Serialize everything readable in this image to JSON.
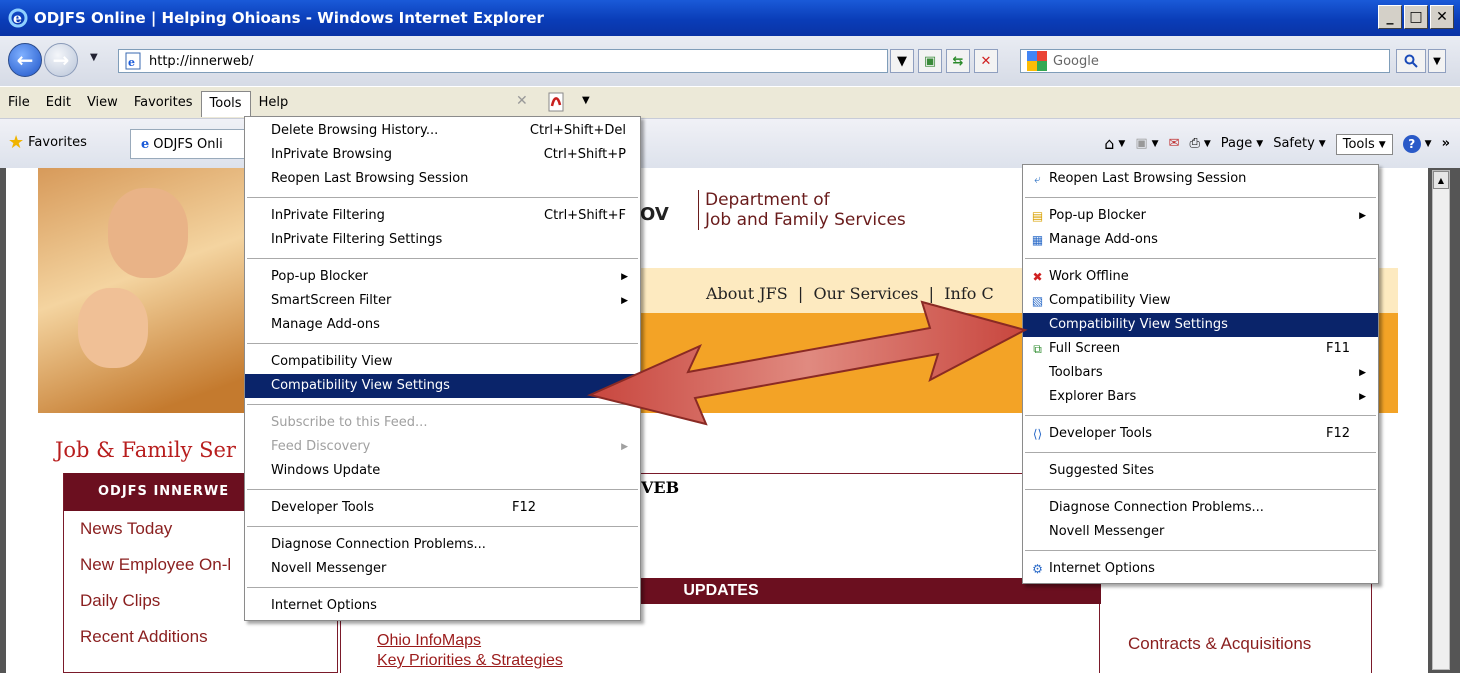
{
  "window": {
    "title": "ODJFS Online | Helping Ohioans - Windows Internet Explorer"
  },
  "address": {
    "url": "http://innerweb/"
  },
  "search": {
    "placeholder": "Google"
  },
  "menubar": [
    "File",
    "Edit",
    "View",
    "Favorites",
    "Tools",
    "Help"
  ],
  "favorites": {
    "label": "Favorites",
    "tab": "ODJFS Onli"
  },
  "commandbar": {
    "page": "Page",
    "safety": "Safety",
    "tools": "Tools"
  },
  "page": {
    "ov_text": "OV",
    "dept_line1": "Department of",
    "dept_line2": "Job and Family Services",
    "nav_text": "About JFS  |  Our Services  |  Info C",
    "site_title": "Job & Family Ser",
    "left_nav_header": "ODJFS INNERWE",
    "left_links": [
      "News Today",
      "New Employee On-l",
      "Daily Clips",
      "Recent Additions"
    ],
    "welcome_partial": "VEB",
    "updates_label": "UPDATES",
    "mid_links": [
      "Ohio InfoMaps",
      "Key Priorities & Strategies"
    ],
    "right_link": "Contracts & Acquisitions"
  },
  "tools_menu": {
    "items": [
      {
        "label": "Delete Browsing History...",
        "shortcut": "Ctrl+Shift+Del"
      },
      {
        "label": "InPrivate Browsing",
        "shortcut": "Ctrl+Shift+P"
      },
      {
        "label": "Reopen Last Browsing Session",
        "shortcut": ""
      },
      {
        "label": "InPrivate Filtering",
        "shortcut": "Ctrl+Shift+F"
      },
      {
        "label": "InPrivate Filtering Settings",
        "shortcut": ""
      },
      {
        "label": "Pop-up Blocker",
        "shortcut": ""
      },
      {
        "label": "SmartScreen Filter",
        "shortcut": ""
      },
      {
        "label": "Manage Add-ons",
        "shortcut": ""
      },
      {
        "label": "Compatibility View",
        "shortcut": ""
      },
      {
        "label": "Compatibility View Settings",
        "shortcut": ""
      },
      {
        "label": "Subscribe to this Feed...",
        "shortcut": ""
      },
      {
        "label": "Feed Discovery",
        "shortcut": ""
      },
      {
        "label": "Windows Update",
        "shortcut": ""
      },
      {
        "label": "Developer Tools",
        "shortcut": "F12"
      },
      {
        "label": "Diagnose Connection Problems...",
        "shortcut": ""
      },
      {
        "label": "Novell Messenger",
        "shortcut": ""
      },
      {
        "label": "Internet Options",
        "shortcut": ""
      }
    ]
  },
  "cmd_tools_menu": {
    "items": [
      {
        "label": "Reopen Last Browsing Session",
        "shortcut": ""
      },
      {
        "label": "Pop-up Blocker",
        "shortcut": ""
      },
      {
        "label": "Manage Add-ons",
        "shortcut": ""
      },
      {
        "label": "Work Offline",
        "shortcut": ""
      },
      {
        "label": "Compatibility View",
        "shortcut": ""
      },
      {
        "label": "Compatibility View Settings",
        "shortcut": ""
      },
      {
        "label": "Full Screen",
        "shortcut": "F11"
      },
      {
        "label": "Toolbars",
        "shortcut": ""
      },
      {
        "label": "Explorer Bars",
        "shortcut": ""
      },
      {
        "label": "Developer Tools",
        "shortcut": "F12"
      },
      {
        "label": "Suggested Sites",
        "shortcut": ""
      },
      {
        "label": "Diagnose Connection Problems...",
        "shortcut": ""
      },
      {
        "label": "Novell Messenger",
        "shortcut": ""
      },
      {
        "label": "Internet Options",
        "shortcut": ""
      }
    ]
  },
  "colors": {
    "titlebar": "#0a3db8",
    "highlight": "#0a246a",
    "brand": "#6b0f1f",
    "arrow": "#b0302a"
  }
}
